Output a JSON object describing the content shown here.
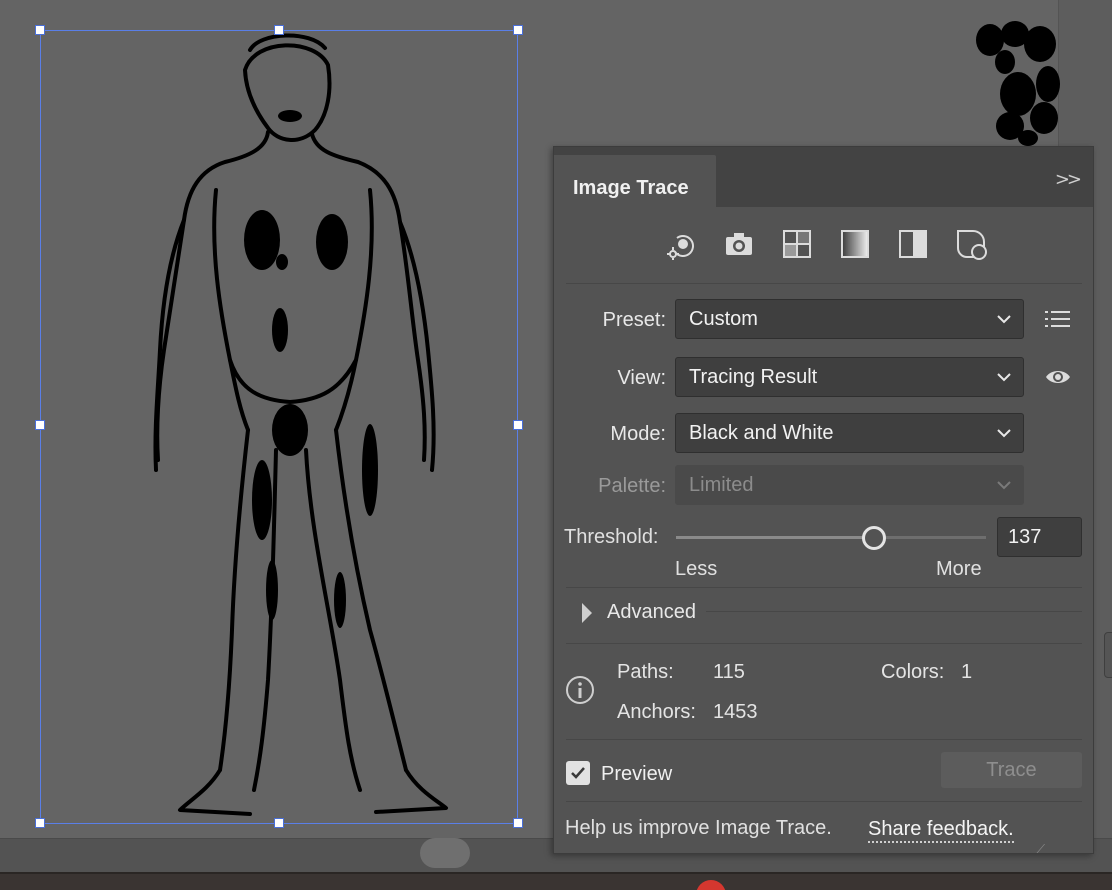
{
  "panel": {
    "title": "Image Trace",
    "collapse_glyph": ">>",
    "preset_icons": [
      "auto-color-icon",
      "high-color-icon",
      "low-color-icon",
      "grayscale-icon",
      "black-and-white-icon",
      "outline-icon"
    ],
    "preset": {
      "label": "Preset:",
      "value": "Custom"
    },
    "view": {
      "label": "View:",
      "value": "Tracing Result"
    },
    "mode": {
      "label": "Mode:",
      "value": "Black and White"
    },
    "palette": {
      "label": "Palette:",
      "value": "Limited",
      "enabled": false
    },
    "threshold": {
      "label": "Threshold:",
      "value": "137",
      "level": 0.64,
      "less": "Less",
      "more": "More"
    },
    "advanced": {
      "label": "Advanced",
      "expanded": false
    },
    "stats": {
      "paths_label": "Paths:",
      "paths_value": "115",
      "colors_label": "Colors:",
      "colors_value": "1",
      "anchors_label": "Anchors:",
      "anchors_value": "1453"
    },
    "preview": {
      "label": "Preview",
      "checked": true
    },
    "trace_button": "Trace",
    "help_text": "Help us improve Image Trace.",
    "feedback_link": "Share feedback."
  },
  "colors": {
    "canvas": "#646464",
    "panel": "#535353",
    "panel_header": "#434343",
    "selection": "#5a7fe8",
    "dock_red": "#d5372f"
  }
}
